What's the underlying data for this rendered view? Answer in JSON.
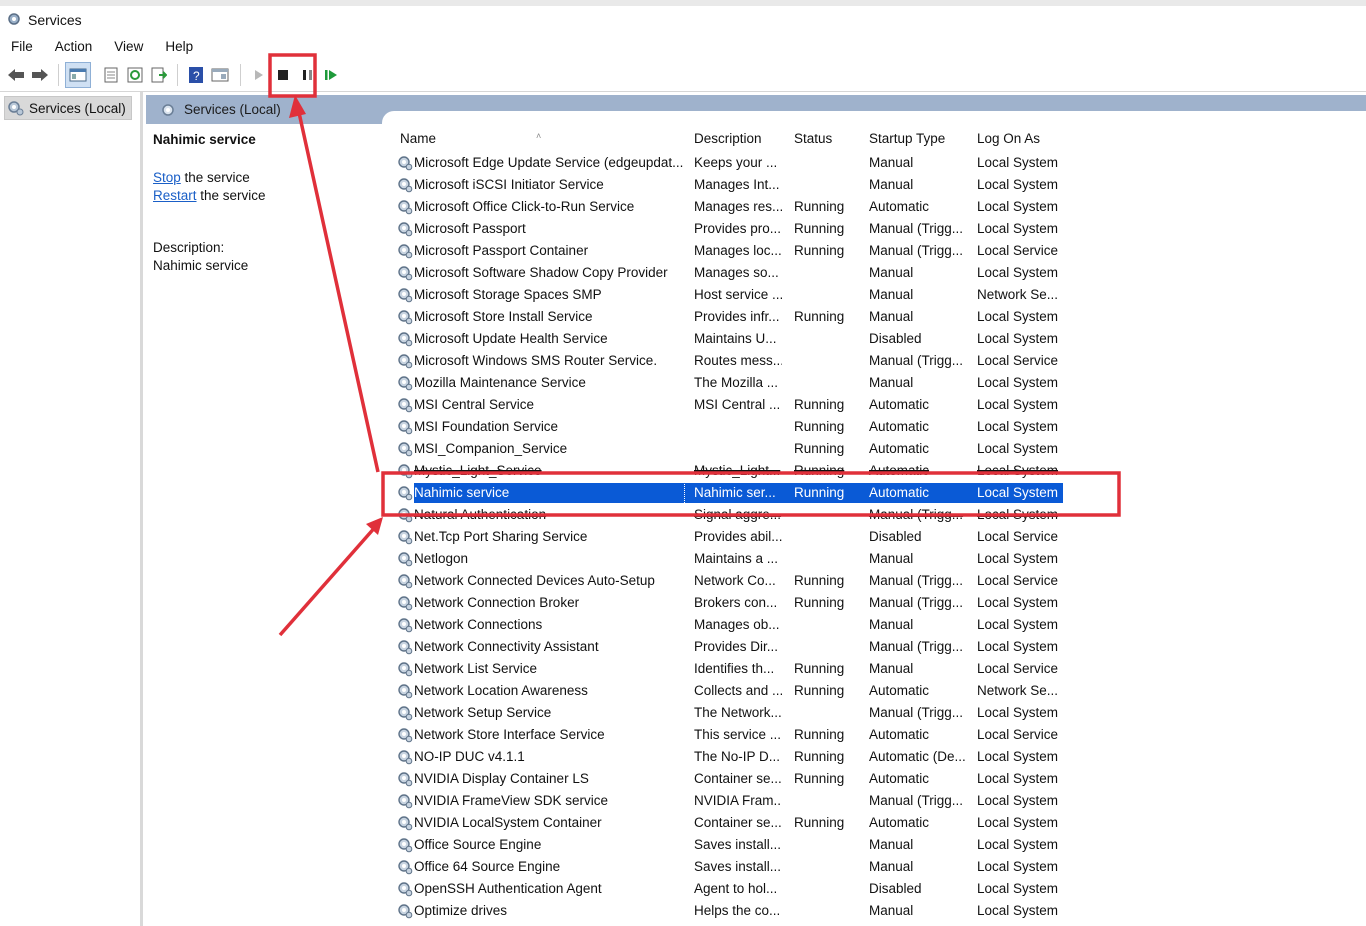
{
  "window": {
    "title": "Services"
  },
  "menu": [
    "File",
    "Action",
    "View",
    "Help"
  ],
  "tree": {
    "root_label": "Services (Local)"
  },
  "panel": {
    "header": "Services (Local)"
  },
  "detail": {
    "service_name": "Nahimic service",
    "stop_link": "Stop",
    "stop_suffix": " the service",
    "restart_link": "Restart",
    "restart_suffix": " the service",
    "description_label": "Description:",
    "description_text": "Nahimic service"
  },
  "table": {
    "columns": [
      "Name",
      "Description",
      "Status",
      "Startup Type",
      "Log On As"
    ],
    "rows": [
      {
        "name": "Microsoft Edge Update Service (edgeupdat...",
        "desc": "Keeps your ...",
        "status": "",
        "startup": "Manual",
        "logon": "Local System"
      },
      {
        "name": "Microsoft iSCSI Initiator Service",
        "desc": "Manages Int...",
        "status": "",
        "startup": "Manual",
        "logon": "Local System"
      },
      {
        "name": "Microsoft Office Click-to-Run Service",
        "desc": "Manages res...",
        "status": "Running",
        "startup": "Automatic",
        "logon": "Local System"
      },
      {
        "name": "Microsoft Passport",
        "desc": "Provides pro...",
        "status": "Running",
        "startup": "Manual (Trigg...",
        "logon": "Local System"
      },
      {
        "name": "Microsoft Passport Container",
        "desc": "Manages loc...",
        "status": "Running",
        "startup": "Manual (Trigg...",
        "logon": "Local Service"
      },
      {
        "name": "Microsoft Software Shadow Copy Provider",
        "desc": "Manages so...",
        "status": "",
        "startup": "Manual",
        "logon": "Local System"
      },
      {
        "name": "Microsoft Storage Spaces SMP",
        "desc": "Host service ...",
        "status": "",
        "startup": "Manual",
        "logon": "Network Se..."
      },
      {
        "name": "Microsoft Store Install Service",
        "desc": "Provides infr...",
        "status": "Running",
        "startup": "Manual",
        "logon": "Local System"
      },
      {
        "name": "Microsoft Update Health Service",
        "desc": "Maintains U...",
        "status": "",
        "startup": "Disabled",
        "logon": "Local System"
      },
      {
        "name": "Microsoft Windows SMS Router Service.",
        "desc": "Routes mess...",
        "status": "",
        "startup": "Manual (Trigg...",
        "logon": "Local Service"
      },
      {
        "name": "Mozilla Maintenance Service",
        "desc": "The Mozilla ...",
        "status": "",
        "startup": "Manual",
        "logon": "Local System"
      },
      {
        "name": "MSI Central Service",
        "desc": "MSI Central ...",
        "status": "Running",
        "startup": "Automatic",
        "logon": "Local System"
      },
      {
        "name": "MSI Foundation Service",
        "desc": "",
        "status": "Running",
        "startup": "Automatic",
        "logon": "Local System"
      },
      {
        "name": "MSI_Companion_Service",
        "desc": "",
        "status": "Running",
        "startup": "Automatic",
        "logon": "Local System"
      },
      {
        "name": "Mystic_Light_Service",
        "desc": "Mystic_Light...",
        "status": "Running",
        "startup": "Automatic",
        "logon": "Local System"
      },
      {
        "name": "Nahimic service",
        "desc": "Nahimic ser...",
        "status": "Running",
        "startup": "Automatic",
        "logon": "Local System"
      },
      {
        "name": "Natural Authentication",
        "desc": "Signal aggre...",
        "status": "",
        "startup": "Manual (Trigg...",
        "logon": "Local System"
      },
      {
        "name": "Net.Tcp Port Sharing Service",
        "desc": "Provides abil...",
        "status": "",
        "startup": "Disabled",
        "logon": "Local Service"
      },
      {
        "name": "Netlogon",
        "desc": "Maintains a ...",
        "status": "",
        "startup": "Manual",
        "logon": "Local System"
      },
      {
        "name": "Network Connected Devices Auto-Setup",
        "desc": "Network Co...",
        "status": "Running",
        "startup": "Manual (Trigg...",
        "logon": "Local Service"
      },
      {
        "name": "Network Connection Broker",
        "desc": "Brokers con...",
        "status": "Running",
        "startup": "Manual (Trigg...",
        "logon": "Local System"
      },
      {
        "name": "Network Connections",
        "desc": "Manages ob...",
        "status": "",
        "startup": "Manual",
        "logon": "Local System"
      },
      {
        "name": "Network Connectivity Assistant",
        "desc": "Provides Dir...",
        "status": "",
        "startup": "Manual (Trigg...",
        "logon": "Local System"
      },
      {
        "name": "Network List Service",
        "desc": "Identifies th...",
        "status": "Running",
        "startup": "Manual",
        "logon": "Local Service"
      },
      {
        "name": "Network Location Awareness",
        "desc": "Collects and ...",
        "status": "Running",
        "startup": "Automatic",
        "logon": "Network Se..."
      },
      {
        "name": "Network Setup Service",
        "desc": "The Network...",
        "status": "",
        "startup": "Manual (Trigg...",
        "logon": "Local System"
      },
      {
        "name": "Network Store Interface Service",
        "desc": "This service ...",
        "status": "Running",
        "startup": "Automatic",
        "logon": "Local Service"
      },
      {
        "name": "NO-IP DUC v4.1.1",
        "desc": "The No-IP D...",
        "status": "Running",
        "startup": "Automatic (De...",
        "logon": "Local System"
      },
      {
        "name": "NVIDIA Display Container LS",
        "desc": "Container se...",
        "status": "Running",
        "startup": "Automatic",
        "logon": "Local System"
      },
      {
        "name": "NVIDIA FrameView SDK service",
        "desc": "NVIDIA Fram...",
        "status": "",
        "startup": "Manual (Trigg...",
        "logon": "Local System"
      },
      {
        "name": "NVIDIA LocalSystem Container",
        "desc": "Container se...",
        "status": "Running",
        "startup": "Automatic",
        "logon": "Local System"
      },
      {
        "name": "Office  Source Engine",
        "desc": "Saves install...",
        "status": "",
        "startup": "Manual",
        "logon": "Local System"
      },
      {
        "name": "Office 64 Source Engine",
        "desc": "Saves install...",
        "status": "",
        "startup": "Manual",
        "logon": "Local System"
      },
      {
        "name": "OpenSSH Authentication Agent",
        "desc": "Agent to hol...",
        "status": "",
        "startup": "Disabled",
        "logon": "Local System"
      },
      {
        "name": "Optimize drives",
        "desc": "Helps the co...",
        "status": "",
        "startup": "Manual",
        "logon": "Local System"
      }
    ],
    "selected_name": "Nahimic service"
  },
  "colors": {
    "selection": "#0a5ad6",
    "annotation": "#e0303a",
    "header_band": "#9fb2cc",
    "link": "#1a5fc7"
  },
  "toolbar_icons": [
    "back-arrow-icon",
    "forward-arrow-icon",
    "console-tree-icon",
    "properties-icon",
    "refresh-icon",
    "export-icon",
    "help-icon",
    "console-icon",
    "start-service-icon",
    "stop-service-icon",
    "pause-service-icon",
    "resume-service-icon"
  ]
}
